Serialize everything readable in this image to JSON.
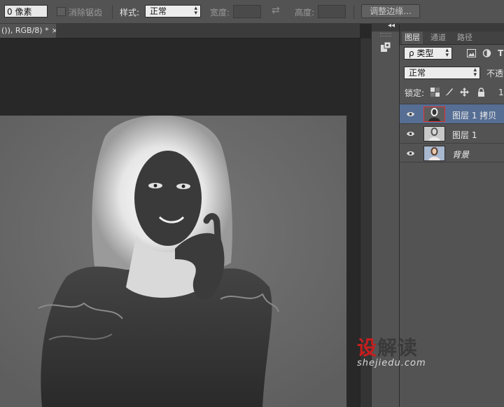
{
  "options_bar": {
    "feather_value": "0 像素",
    "antialias_label": "消除锯齿",
    "style_label": "样式:",
    "style_value": "正常",
    "width_label": "宽度:",
    "height_label": "高度:",
    "refine_edge_button": "调整边缘..."
  },
  "document": {
    "tab_title": "()), RGB/8) *",
    "tab_close": "×"
  },
  "panel_strip": {
    "collapse_glyph": "◂◂"
  },
  "layers_panel": {
    "tabs": [
      "图层",
      "通道",
      "路径"
    ],
    "filter_kind": "ρ 类型",
    "blend_mode": "正常",
    "opacity_label": "不透明",
    "lock_label": "锁定:",
    "layers": [
      {
        "name": "图层 1 拷贝",
        "selected": true,
        "visible": true,
        "italic": false
      },
      {
        "name": "图层 1",
        "selected": false,
        "visible": true,
        "italic": false
      },
      {
        "name": "背景",
        "selected": false,
        "visible": true,
        "italic": true
      }
    ]
  },
  "watermark": {
    "title_red": "设",
    "title_dark": "解读",
    "url": "shejiedu.com"
  },
  "colors": {
    "accent_selected": "#566e93",
    "thumb_outline": "#e43030",
    "watermark_red": "#c81e1e"
  }
}
